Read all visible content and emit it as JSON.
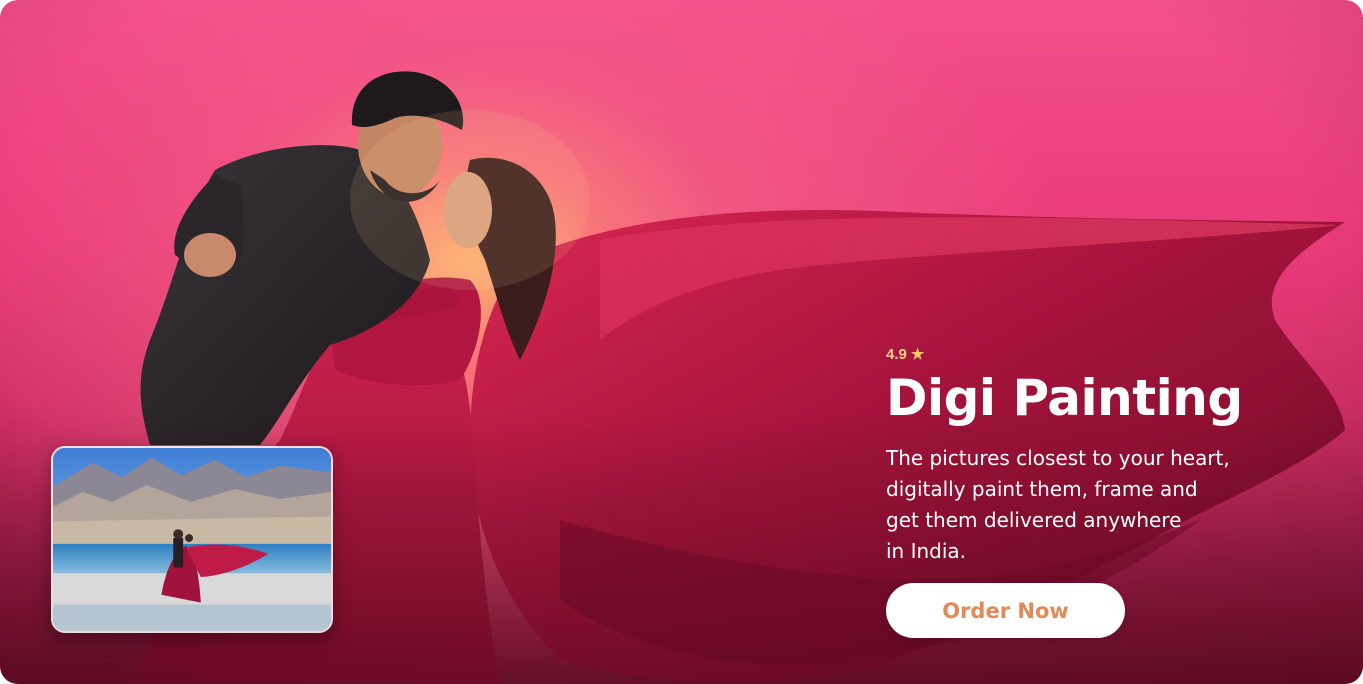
{
  "banner": {
    "rating": "4.9",
    "rating_icon": "star-icon",
    "title": "Digi Painting",
    "description_lines": [
      "The pictures closest to your heart,",
      "digitally paint them, frame and",
      "get them delivered anywhere",
      "in India."
    ],
    "cta_label": "Order Now",
    "colors": {
      "background_primary": "#ea3b7a",
      "background_dark": "#7d1430",
      "glow": "#ffbe6e",
      "dress": "#b3163f",
      "rating_text": "#f7d08a",
      "cta_text": "#e08a5a",
      "cta_background": "#ffffff"
    }
  }
}
